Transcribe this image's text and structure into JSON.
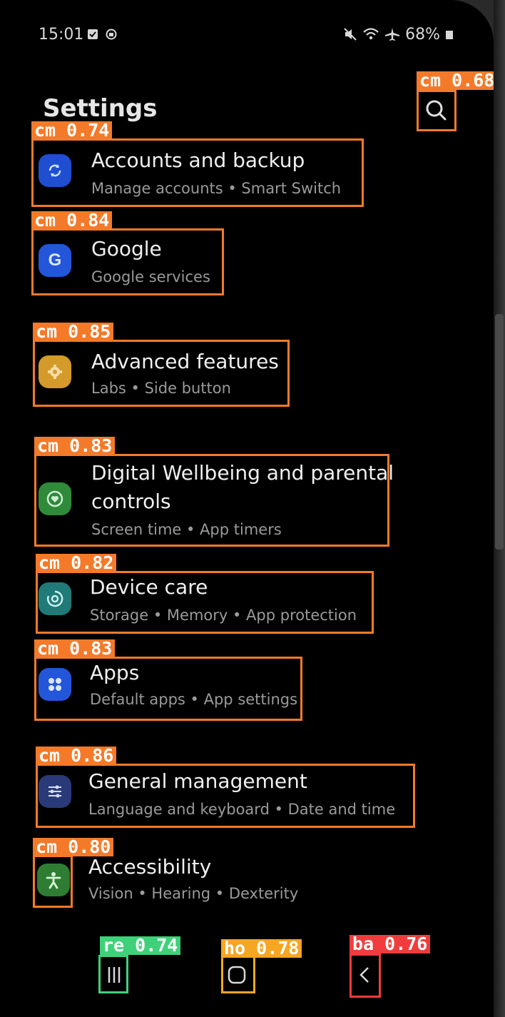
{
  "status_bar": {
    "time": "15:01",
    "battery": "68%"
  },
  "header": {
    "title": "Settings"
  },
  "items": [
    {
      "title": "Accounts and backup",
      "subtitle": "Manage accounts  •  Smart Switch",
      "icon": "sync-icon",
      "color": "#1f4fd0"
    },
    {
      "title": "Google",
      "subtitle": "Google services",
      "icon": "google-icon",
      "color": "#2356d8"
    },
    {
      "title": "Advanced features",
      "subtitle": "Labs  •  Side button",
      "icon": "puzzle-gear-icon",
      "color": "#d49a2a"
    },
    {
      "title": "Digital Wellbeing and parental",
      "title2": "controls",
      "subtitle": "Screen time  •  App timers",
      "icon": "wellbeing-icon",
      "color": "#2f8a3a"
    },
    {
      "title": "Device care",
      "subtitle": "Storage  •  Memory  •  App protection",
      "icon": "device-care-icon",
      "color": "#1f7a78"
    },
    {
      "title": "Apps",
      "subtitle": "Default apps  •  App settings",
      "icon": "apps-grid-icon",
      "color": "#2356d8"
    },
    {
      "title": "General management",
      "subtitle": "Language and keyboard  •  Date and time",
      "icon": "sliders-icon",
      "color": "#2a3a78"
    },
    {
      "title": "Accessibility",
      "subtitle": "Vision  •  Hearing  •  Dexterity",
      "icon": "accessibility-icon",
      "color": "#2e7d32"
    }
  ],
  "detections": {
    "search": "cm 0.68",
    "items": [
      "cm 0.74",
      "cm 0.84",
      "cm 0.85",
      "cm 0.83",
      "cm 0.82",
      "cm 0.83",
      "cm 0.86",
      "cm 0.80"
    ],
    "recent": "re 0.74",
    "home": "ho 0.78",
    "back": "ba 0.76"
  },
  "colors": {
    "detection_cm": "#f47a2a",
    "detection_re": "#3fd17a",
    "detection_ho": "#f5a623",
    "detection_ba": "#f03c3c"
  }
}
